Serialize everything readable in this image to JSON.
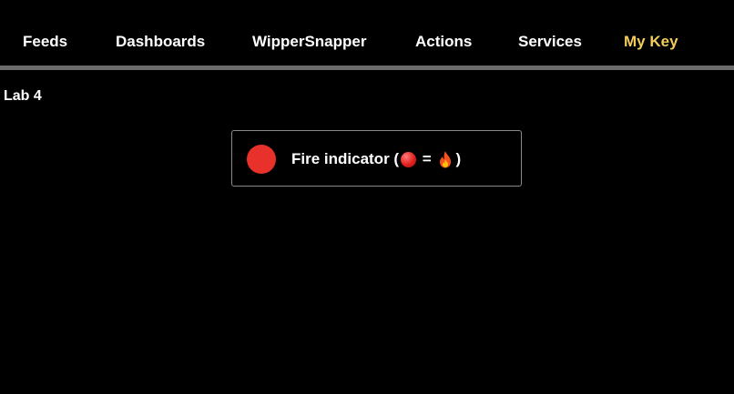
{
  "nav": {
    "items": [
      {
        "label": "Feeds"
      },
      {
        "label": "Dashboards"
      },
      {
        "label": "WipperSnapper"
      },
      {
        "label": "Actions"
      },
      {
        "label": "Services"
      },
      {
        "label": "My Key"
      }
    ]
  },
  "dashboard": {
    "title": "Lab 4"
  },
  "indicator_block": {
    "label_prefix": "Fire indicator (",
    "label_equals": " = ",
    "label_suffix": ")",
    "state": "on",
    "on_color": "#e8312b",
    "icons": [
      "red-circle-icon",
      "fire-icon"
    ]
  },
  "colors": {
    "background": "#000000",
    "accent": "#f2cd5c",
    "divider": "#6b6b6b",
    "block_border": "#8a8a8a"
  }
}
